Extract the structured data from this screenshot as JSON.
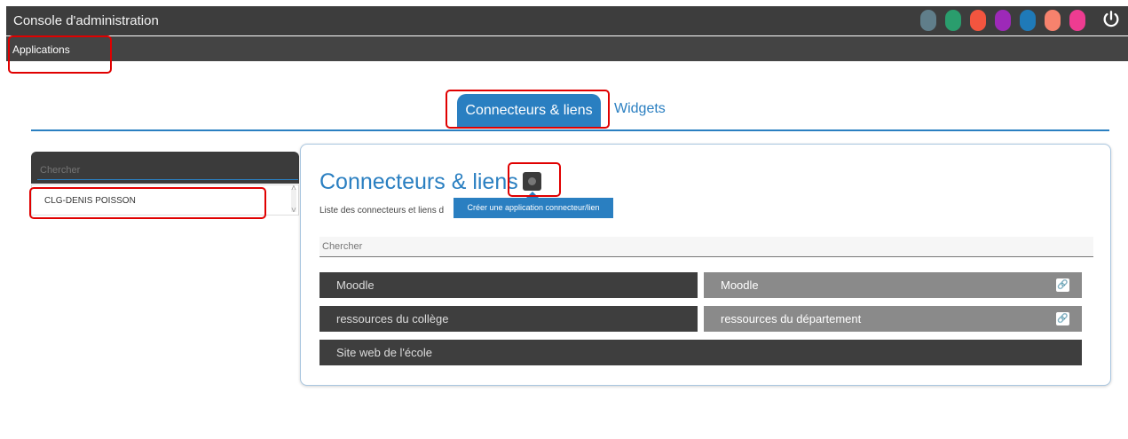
{
  "header": {
    "title": "Console d'administration",
    "theme_colors": [
      "#607e8a",
      "#2a9d6d",
      "#f3553f",
      "#9d29b8",
      "#1f7ab8",
      "#f6826d",
      "#ee3c91"
    ]
  },
  "subnav": {
    "applications_label": "Applications"
  },
  "tabs": [
    {
      "label": "Connecteurs & liens",
      "active": true
    },
    {
      "label": "Widgets",
      "active": false
    }
  ],
  "sidebar": {
    "search_placeholder": "Chercher",
    "items": [
      {
        "label": "CLG-DENIS POISSON"
      }
    ]
  },
  "main": {
    "title": "Connecteurs & liens",
    "description": "Liste des connecteurs et liens d",
    "tooltip": "Créer une application connecteur/lien",
    "search_placeholder": "Chercher",
    "apps": [
      {
        "label": "Moodle",
        "style": "dark",
        "link_icon": false
      },
      {
        "label": "Moodle",
        "style": "grey",
        "link_icon": true
      },
      {
        "label": "ressources du collège",
        "style": "dark",
        "link_icon": false
      },
      {
        "label": "ressources du département",
        "style": "grey",
        "link_icon": true
      },
      {
        "label": "Site web de l'école",
        "style": "dark",
        "link_icon": false
      }
    ]
  }
}
